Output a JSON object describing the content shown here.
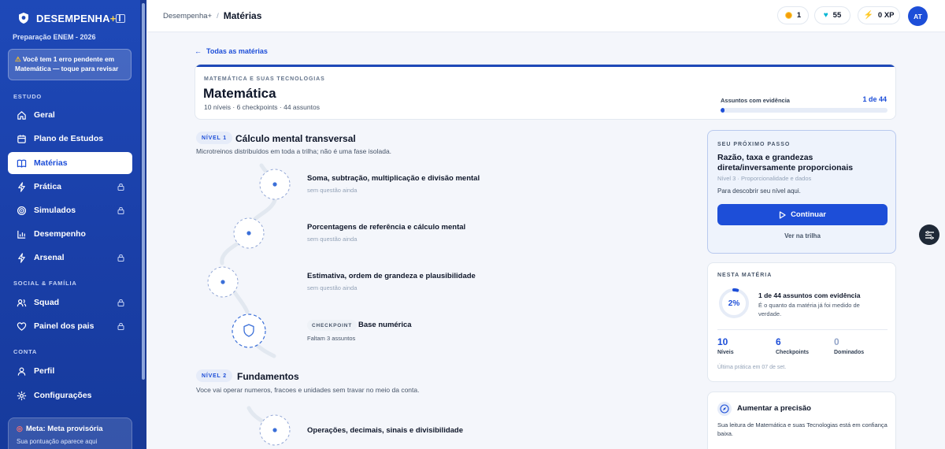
{
  "sidebar": {
    "brand": "DESEMPENHA",
    "brand_plus": "+",
    "subtitle": "Preparação ENEM - 2026",
    "alert": "Você tem 1 erro pendente em Matemática — toque para revisar",
    "sections": {
      "estudo": "ESTUDO",
      "social": "SOCIAL & FAMÍLIA",
      "conta": "CONTA"
    },
    "items": [
      {
        "label": "Geral",
        "icon": "home-icon",
        "locked": false,
        "active": false
      },
      {
        "label": "Plano de Estudos",
        "icon": "calendar-icon",
        "locked": false,
        "active": false
      },
      {
        "label": "Matérias",
        "icon": "book-icon",
        "locked": false,
        "active": true
      },
      {
        "label": "Prática",
        "icon": "bolt-icon",
        "locked": true,
        "active": false
      },
      {
        "label": "Simulados",
        "icon": "target-icon",
        "locked": true,
        "active": false
      },
      {
        "label": "Desempenho",
        "icon": "bar-chart-icon",
        "locked": false,
        "active": false
      },
      {
        "label": "Arsenal",
        "icon": "bolt-icon",
        "locked": true,
        "active": false
      },
      {
        "label": "Squad",
        "icon": "users-icon",
        "locked": true,
        "active": false
      },
      {
        "label": "Painel dos pais",
        "icon": "heart-icon",
        "locked": true,
        "active": false
      },
      {
        "label": "Perfil",
        "icon": "user-icon",
        "locked": false,
        "active": false
      },
      {
        "label": "Configurações",
        "icon": "gear-icon",
        "locked": false,
        "active": false
      }
    ],
    "meta_title": "Meta: Meta provisória",
    "meta_sub": "Sua pontuação aparece aqui"
  },
  "topbar": {
    "crumb_parent": "Desempenha+",
    "crumb_sep": "/",
    "crumb_current": "Matérias",
    "coins": "1",
    "gems": "55",
    "xp": "0 XP",
    "avatar": "AT"
  },
  "main": {
    "back": "Todas as matérias",
    "area": "MATEMÁTICA E SUAS TECNOLOGIAS",
    "title": "Matemática",
    "meta": "10 níveis · 6 checkpoints · 44 assuntos",
    "progress_label": "Assuntos com evidência",
    "progress_value": "1 de 44",
    "progress_fraction": 0.023,
    "levels": [
      {
        "badge": "NÍVEL 1",
        "title": "Cálculo mental transversal",
        "desc": "Microtreinos distribuídos em toda a trilha; não é uma fase isolada.",
        "topics": [
          {
            "name": "Soma, subtração, multiplicação e divisão mental",
            "status": "sem questão ainda"
          },
          {
            "name": "Porcentagens de referência e cálculo mental",
            "status": "sem questão ainda"
          },
          {
            "name": "Estimativa, ordem de grandeza e plausibilidade",
            "status": "sem questão ainda"
          }
        ],
        "checkpoint": {
          "badge": "CHECKPOINT",
          "name": "Base numérica",
          "status": "Faltam 3 assuntos"
        }
      },
      {
        "badge": "NÍVEL 2",
        "title": "Fundamentos",
        "desc": "Voce vai operar numeros, fracoes e unidades sem travar no meio da conta.",
        "topics": [
          {
            "name": "Operações, decimais, sinais e divisibilidade",
            "status": ""
          }
        ]
      }
    ]
  },
  "next_step": {
    "label": "SEU PRÓXIMO PASSO",
    "title": "Razão, taxa e grandezas direta/inversamente proporcionais",
    "level": "Nível 3 · Proporcionalidade e dados",
    "hint": "Para descobrir seu nível aqui.",
    "button": "Continuar",
    "link": "Ver na trilha"
  },
  "stats": {
    "label": "NESTA MATÉRIA",
    "percent": "2%",
    "percent_value": 0.023,
    "main": "1 de 44 assuntos com evidência",
    "sub": "É o quanto da matéria já foi medido de verdade.",
    "items": [
      {
        "num": "10",
        "label": "Níveis"
      },
      {
        "num": "6",
        "label": "Checkpoints"
      },
      {
        "num": "0",
        "label": "Dominados"
      }
    ],
    "foot": "Última prática em 07 de set."
  },
  "precision": {
    "title": "Aumentar a precisão",
    "text": "Sua leitura de Matemática e suas Tecnologias está em confiança baixa."
  },
  "colors": {
    "primary": "#1d4ed8",
    "sidebar": "#1e49b8",
    "accent": "#fcd34d"
  }
}
